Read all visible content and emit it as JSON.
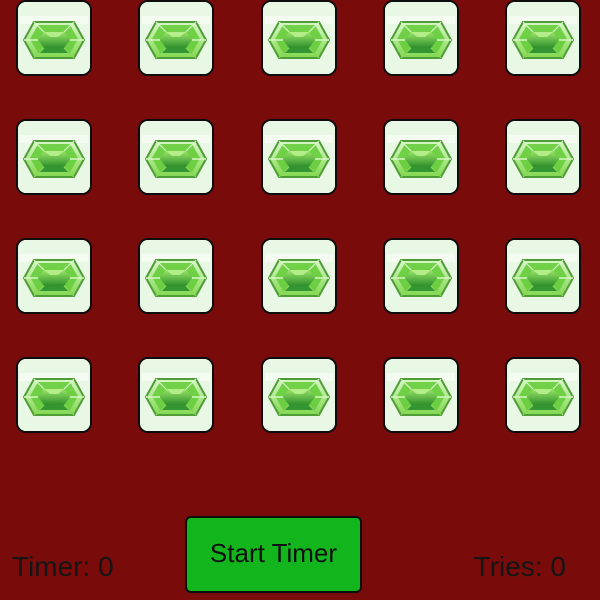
{
  "board": {
    "rows": 4,
    "columns": 5,
    "card_face": "green-gem-icon",
    "colors": {
      "background": "#7a0b0b",
      "card_fill": "#e9f8e4",
      "gem_green": "#5fc82f",
      "button_green": "#12b61c"
    }
  },
  "controls": {
    "start_timer_label": "Start Timer",
    "timer_label": "Timer:",
    "timer_value": "0",
    "tries_label": "Tries:",
    "tries_value": "0"
  }
}
